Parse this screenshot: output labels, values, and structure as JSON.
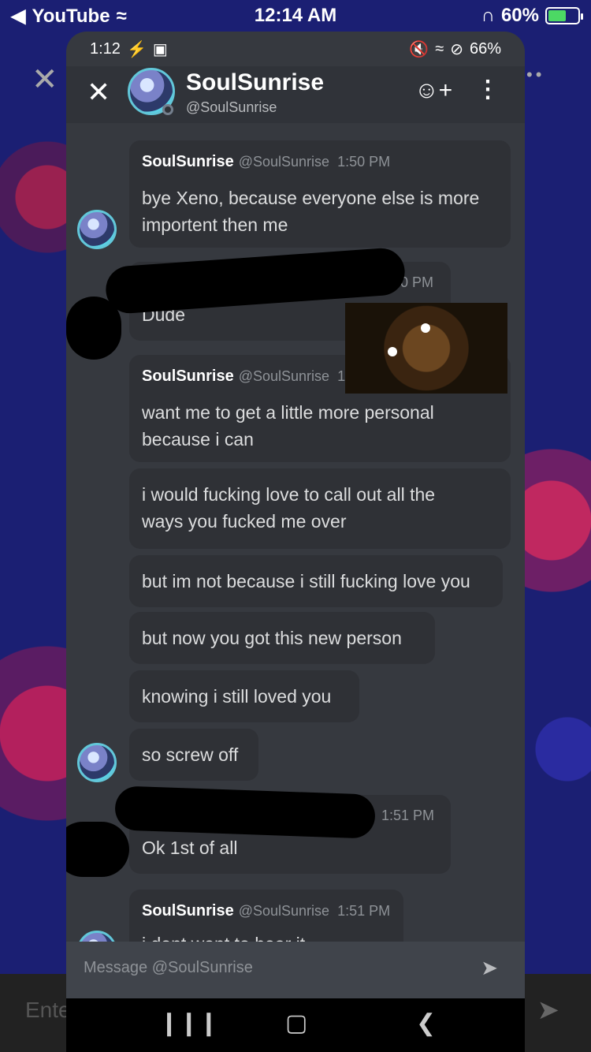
{
  "ios_status": {
    "app_back": "YouTube",
    "time": "12:14 AM",
    "battery": "60%",
    "battery_level": 0.6
  },
  "background_app": {
    "input_placeholder": "Ente"
  },
  "android_status": {
    "time": "1:12",
    "battery": "66%"
  },
  "header": {
    "name": "SoulSunrise",
    "handle": "@SoulSunrise"
  },
  "messages": [
    {
      "author": "SoulSunrise",
      "handle": "@SoulSunrise",
      "time": "1:50 PM",
      "lines": [
        "bye Xeno, because everyone else is more",
        "importent then me"
      ]
    },
    {
      "time_partial": "0 PM",
      "lines": [
        "Dude"
      ]
    },
    {
      "author": "SoulSunrise",
      "handle": "@SoulSunrise",
      "time_partial": "1",
      "lines": [
        "want me to get a little more personal",
        "because i can"
      ]
    },
    {
      "lines": [
        "i would fucking love to call out all the",
        "ways you fucked me over"
      ]
    },
    {
      "lines": [
        "but im not because i still fucking love you"
      ]
    },
    {
      "lines": [
        "but now you got this new person"
      ]
    },
    {
      "lines": [
        "knowing i still loved you"
      ]
    },
    {
      "lines": [
        "so screw off"
      ]
    },
    {
      "time": "1:51 PM",
      "lines": [
        "Ok 1st of all"
      ]
    },
    {
      "author": "SoulSunrise",
      "handle": "@SoulSunrise",
      "time": "1:51 PM",
      "lines": [
        "i dont want to hear it"
      ]
    }
  ],
  "input": {
    "placeholder": "Message @SoulSunrise"
  },
  "icons": [
    "back-arrow-icon",
    "wifi-icon",
    "headphones-icon",
    "battery-icon",
    "close-icon",
    "add-friend-icon",
    "more-icon",
    "send-icon",
    "recent-apps-icon",
    "home-icon",
    "back-icon"
  ]
}
